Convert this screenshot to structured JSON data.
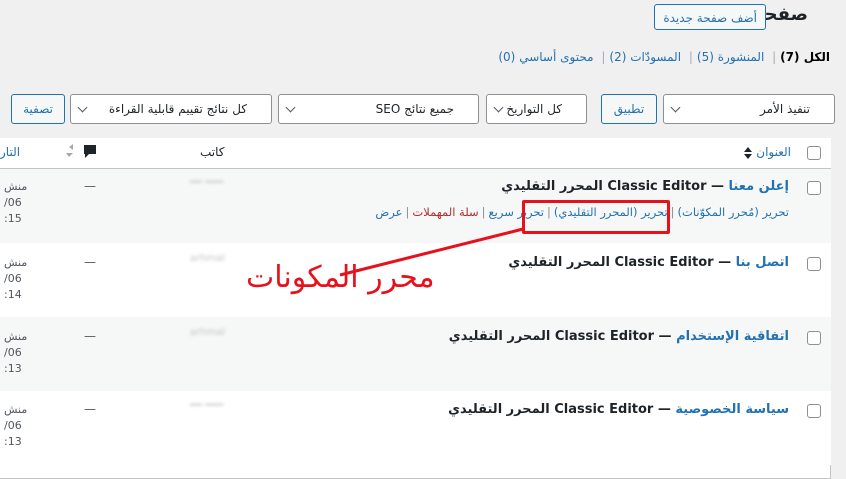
{
  "header": {
    "title": "صفحات",
    "add_new": "أضف صفحة جديدة"
  },
  "views": [
    {
      "label": "الكل",
      "count": "(7)",
      "current": true
    },
    {
      "label": "المنشورة",
      "count": "(5)"
    },
    {
      "label": "المسودّات",
      "count": "(2)"
    },
    {
      "label": "محتوى أساسي",
      "count": "(0)"
    }
  ],
  "filters": {
    "bulk_action": "تنفيذ الأمر",
    "apply": "تطبيق",
    "dates": "كل التواريخ",
    "seo": "جميع نتائج SEO",
    "readability": "كل نتائج تقييم قابلية القراءة",
    "filter": "تصفية"
  },
  "columns": {
    "title": "العنوان",
    "author": "كاتب",
    "date": "التار"
  },
  "rows": [
    {
      "title": "إعلن معنا",
      "state": " — Classic Editor المحرر التقليدي",
      "date1": "منش",
      "date2": "/06",
      "date3": ":15"
    },
    {
      "title": "اتصل بنا",
      "state": " — Classic Editor المحرر التقليدي",
      "author": "arhmal",
      "date1": "منش",
      "date2": "/06",
      "date3": ":14"
    },
    {
      "title": "اتفاقية الإستخدام",
      "state": " — Classic Editor المحرر التقليدي",
      "author": "arhmal",
      "date1": "منش",
      "date2": "/06",
      "date3": ":13"
    },
    {
      "title": "سياسة الخصوصية",
      "state": " — Classic Editor المحرر التقليدي",
      "date1": "منش",
      "date2": "/06",
      "date3": ":13"
    }
  ],
  "row_actions": {
    "edit_blocks": "تحرير (مُحرر المكوّنات)",
    "edit_classic": "تحرير (المحرر التقليدي)",
    "quick_edit": "تحرير سريع",
    "trash": "سلة المهملات",
    "view": "عرض"
  },
  "placeholder_dash": "—",
  "annotation": {
    "text": "محرر المكونات",
    "color": "#e8101a"
  }
}
